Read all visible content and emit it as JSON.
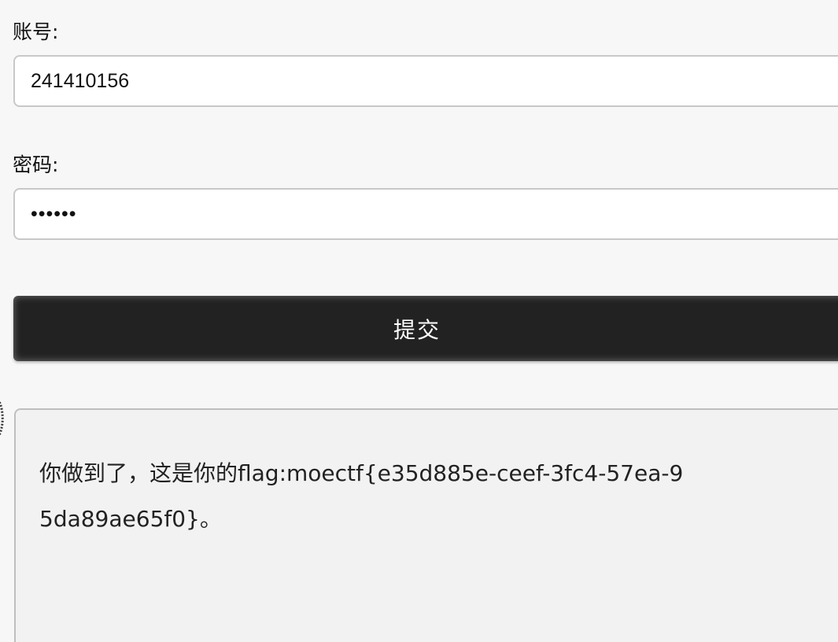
{
  "form": {
    "account_label": "账号:",
    "account_value": "241410156",
    "password_label": "密码:",
    "password_value": "123456",
    "submit_label": "提交"
  },
  "result": {
    "message": "你做到了，这是你的flag:moectf{e35d885e-ceef-3fc4-57ea-95da89ae65f0}。"
  }
}
